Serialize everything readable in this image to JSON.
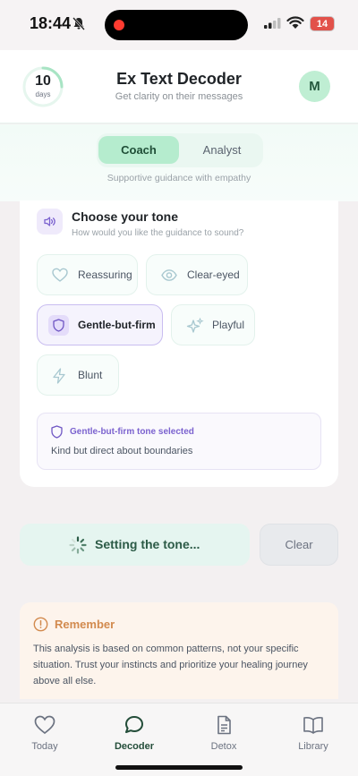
{
  "status_bar": {
    "time": "18:44",
    "battery": "14",
    "icons": [
      "bell-slash-icon",
      "signal-icon",
      "wifi-icon",
      "battery-icon"
    ]
  },
  "header": {
    "streak_number": "10",
    "streak_unit": "days",
    "title": "Ex Text Decoder",
    "subtitle": "Get clarity on their messages",
    "avatar_initial": "M"
  },
  "mode": {
    "tabs": [
      {
        "label": "Coach",
        "selected": true
      },
      {
        "label": "Analyst",
        "selected": false
      }
    ],
    "caption": "Supportive guidance with empathy"
  },
  "tone": {
    "heading": "Choose your tone",
    "subheading": "How would you like the guidance to sound?",
    "options": [
      {
        "label": "Reassuring",
        "icon": "heart-icon",
        "selected": false
      },
      {
        "label": "Clear-eyed",
        "icon": "eye-icon",
        "selected": false
      },
      {
        "label": "Gentle-but-firm",
        "icon": "shield-icon",
        "selected": true
      },
      {
        "label": "Playful",
        "icon": "sparkles-icon",
        "selected": false
      },
      {
        "label": "Blunt",
        "icon": "lightning-icon",
        "selected": false
      }
    ],
    "selection_title": "Gentle-but-firm tone selected",
    "selection_desc": "Kind but direct about boundaries"
  },
  "actions": {
    "setting_label": "Setting the tone...",
    "clear_label": "Clear"
  },
  "notice": {
    "title": "Remember",
    "text": "This analysis is based on common patterns, not your specific situation. Trust your instincts and prioritize your healing journey above all else."
  },
  "nav": {
    "items": [
      {
        "label": "Today",
        "icon": "heart-icon",
        "active": false
      },
      {
        "label": "Decoder",
        "icon": "chat-bubble-icon",
        "active": true
      },
      {
        "label": "Detox",
        "icon": "document-icon",
        "active": false
      },
      {
        "label": "Library",
        "icon": "book-icon",
        "active": false
      }
    ]
  },
  "colors": {
    "accent_green": "#b5ecce",
    "accent_purple": "#7b62cf",
    "warning_orange": "#d28a4e"
  }
}
